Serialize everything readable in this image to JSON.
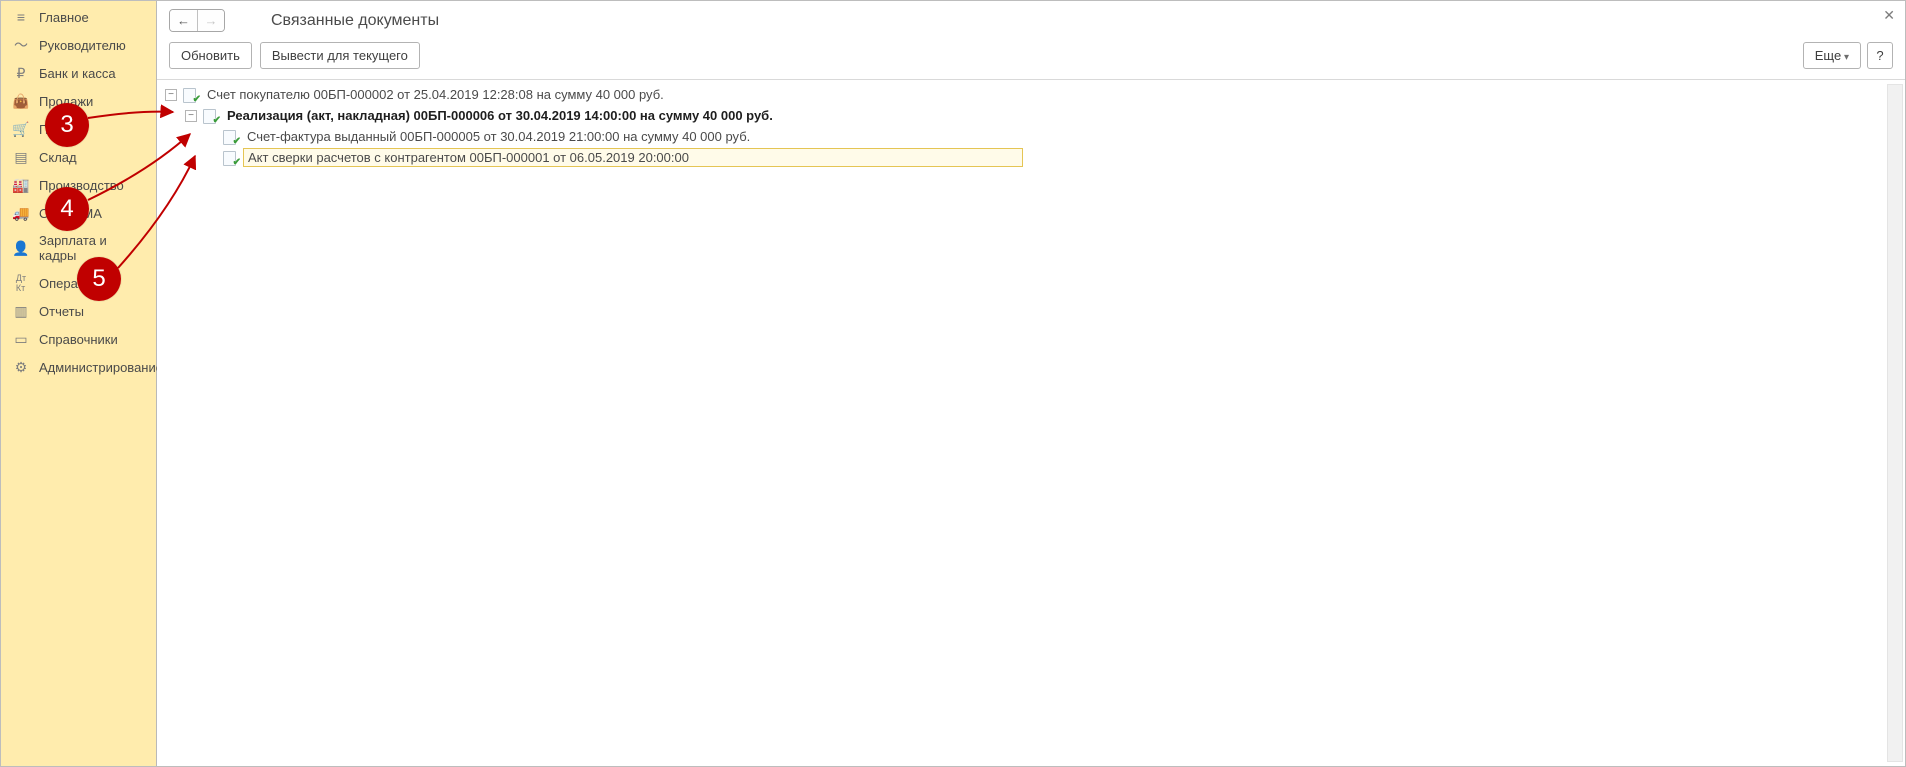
{
  "sidebar": {
    "items": [
      {
        "label": "Главное",
        "icon": "menu-icon"
      },
      {
        "label": "Руководителю",
        "icon": "chart-line-icon"
      },
      {
        "label": "Банк и касса",
        "icon": "ruble-icon"
      },
      {
        "label": "Продажи",
        "icon": "bag-icon"
      },
      {
        "label": "Покупки",
        "icon": "cart-icon"
      },
      {
        "label": "Склад",
        "icon": "boxes-icon"
      },
      {
        "label": "Производство",
        "icon": "factory-icon"
      },
      {
        "label": "ОС и НМА",
        "icon": "truck-icon"
      },
      {
        "label": "Зарплата и кадры",
        "icon": "person-icon"
      },
      {
        "label": "Операции",
        "icon": "dtkt-icon"
      },
      {
        "label": "Отчеты",
        "icon": "barchart-icon"
      },
      {
        "label": "Справочники",
        "icon": "book-icon"
      },
      {
        "label": "Администрирование",
        "icon": "gear-icon"
      }
    ]
  },
  "header": {
    "title": "Связанные документы"
  },
  "toolbar": {
    "refresh_label": "Обновить",
    "export_label": "Вывести для текущего",
    "more_label": "Еще",
    "help_label": "?"
  },
  "tree": {
    "nodes": [
      {
        "label": "Счет покупателю 00БП-000002 от 25.04.2019 12:28:08 на сумму 40 000 руб.",
        "bold": false,
        "children": [
          {
            "label": "Реализация (акт, накладная) 00БП-000006 от 30.04.2019 14:00:00 на сумму 40 000 руб.",
            "bold": true,
            "children": [
              {
                "label": "Счет-фактура выданный 00БП-000005 от 30.04.2019 21:00:00 на сумму 40 000 руб.",
                "bold": false
              },
              {
                "label": "Акт сверки расчетов с контрагентом 00БП-000001 от 06.05.2019 20:00:00",
                "bold": false,
                "selected": true
              }
            ]
          }
        ]
      }
    ]
  },
  "annotations": {
    "badges": [
      {
        "num": "3"
      },
      {
        "num": "4"
      },
      {
        "num": "5"
      }
    ]
  }
}
